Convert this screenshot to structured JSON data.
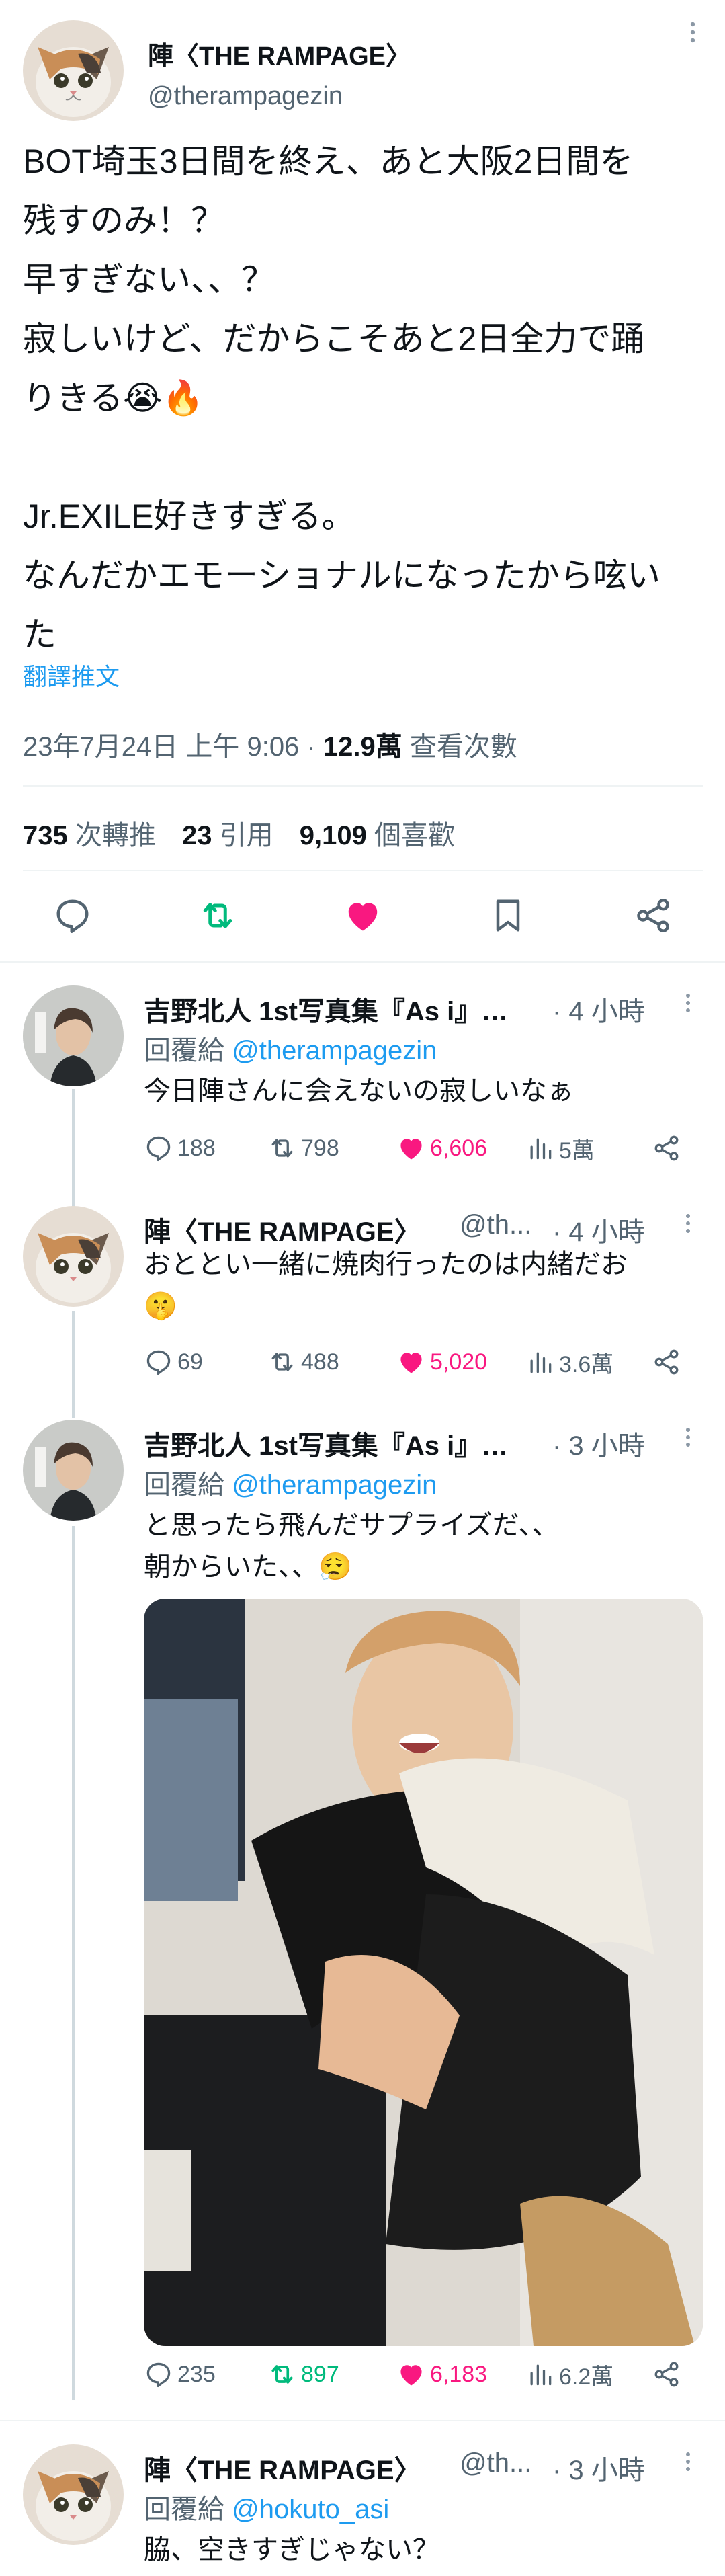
{
  "main_tweet": {
    "author_name": "陣〈THE RAMPAGE〉",
    "author_handle": "@therampagezin",
    "body": "BOT埼玉3日間を終え、あと大阪2日間を\n残すのみ！？\n早すぎない、、？\n寂しいけど、だからこそあと2日全力で踊\nりきる😭🔥\n\nJr.EXILE好きすぎる。\nなんだかエモーショナルになったから呟い\nた",
    "translate_label": "翻譯推文",
    "timestamp": "23年7月24日 上午 9:06",
    "separator": " · ",
    "views_count": "12.9萬",
    "views_label": " 查看次數",
    "retweets_count": "735",
    "retweets_label": "次轉推",
    "quotes_count": "23",
    "quotes_label": "引用",
    "likes_count": "9,109",
    "likes_label": "個喜歡",
    "liked": true,
    "retweeted": true
  },
  "replies": [
    {
      "author_name": "吉野北人 1st写真集『As i』…",
      "handle": "",
      "time": "· 4 小時",
      "reply_prefix": "回覆給 ",
      "reply_to": "@therampagezin",
      "text": "今日陣さんに会えないの寂しいなぁ",
      "replies": "188",
      "retweets": "798",
      "likes": "6,606",
      "views": "5萬",
      "liked": true,
      "retweeted": false
    },
    {
      "author_name": "陣〈THE RAMPAGE〉",
      "handle": "@th...",
      "time": "· 4 小時",
      "text": "おととい一緒に焼肉行ったのは内緒だお\n🤫",
      "replies": "69",
      "retweets": "488",
      "likes": "5,020",
      "views": "3.6萬",
      "liked": true,
      "retweeted": false
    },
    {
      "author_name": "吉野北人 1st写真集『As i』…",
      "handle": "",
      "time": "· 3 小時",
      "reply_prefix": "回覆給 ",
      "reply_to": "@therampagezin",
      "text": "と思ったら飛んだサプライズだ、、\n朝からいた、、😮‍💨",
      "replies": "235",
      "retweets": "897",
      "likes": "6,183",
      "views": "6.2萬",
      "liked": true,
      "retweeted": true
    },
    {
      "author_name": "陣〈THE RAMPAGE〉",
      "handle": "@th...",
      "time": "· 3 小時",
      "reply_prefix": "回覆給 ",
      "reply_to": "@hokuto_asi",
      "text": "脇、空きすぎじゃない？"
    }
  ],
  "colors": {
    "accent": "#1d9bf0",
    "like": "#f91880",
    "retweet": "#00ba7c",
    "muted": "#536471"
  },
  "icons": [
    "reply-icon",
    "retweet-icon",
    "heart-icon",
    "bookmark-icon",
    "share-icon",
    "views-icon",
    "more-icon"
  ]
}
